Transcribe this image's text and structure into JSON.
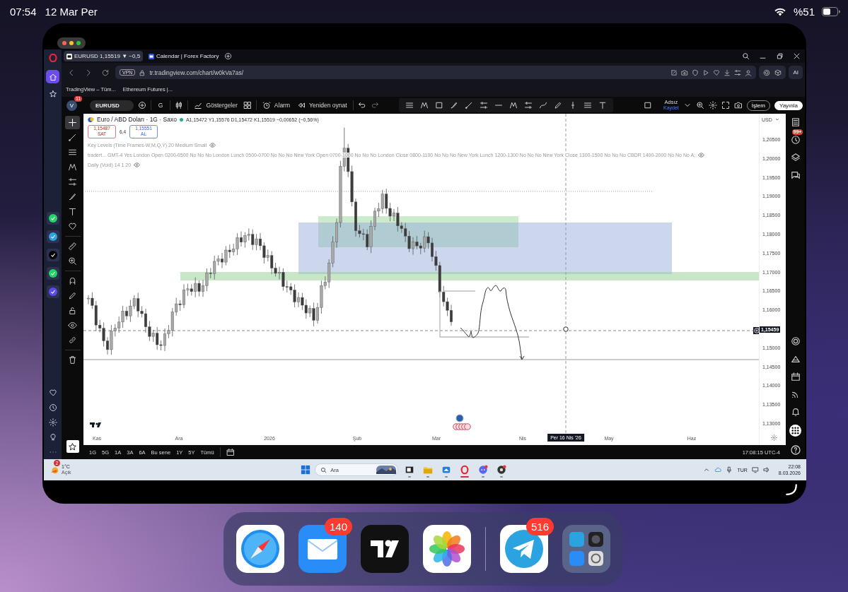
{
  "status_bar": {
    "time": "07:54",
    "date": "12 Mar Per",
    "battery": "%51"
  },
  "opera_sidebar": {
    "items": [
      {
        "selected": true
      },
      {
        "selected": false
      }
    ]
  },
  "browser": {
    "tabs": [
      {
        "label": "EURUSD 1,15519 ▼ −0,5",
        "selected": true
      },
      {
        "label": "Calendar | Forex Factory",
        "selected": false
      }
    ],
    "vpn": "VPN",
    "address": "tr.tradingview.com/chart/w0kVa7as/",
    "ai": "AI",
    "bookmarks": [
      "TradingView – Tüm...",
      "Ethereum Futures |..."
    ]
  },
  "toolbar": {
    "avatar": "V",
    "notifications": "11",
    "symbol": "EURUSD",
    "interval": "G",
    "indicators": "Göstergeler",
    "alert": "Alarm",
    "replay": "Yeniden oynat",
    "layout_name": "Adsız",
    "layout_status": "Kaydet",
    "trade": "İşlem",
    "publish": "Yayınla"
  },
  "left_toolbar": {
    "tools": [
      {
        "selected": true
      },
      {
        "selected": false
      },
      {
        "selected": false
      },
      {
        "selected": false
      },
      {
        "selected": false
      },
      {
        "selected": false
      },
      {
        "selected": false
      },
      {
        "selected": false
      },
      {
        "selected": false
      },
      {
        "selected": false
      },
      {
        "selected": false
      },
      {
        "selected": false
      },
      {
        "selected": false
      },
      {
        "selected": false
      },
      {
        "selected": false
      },
      {
        "selected": false
      }
    ]
  },
  "legend": {
    "title": "Euro / ABD Doları · 1G · Saxo",
    "ohlc": "A1,15472 Y1,15576 D1,15472 K1,15519 −0,00652 (−0,56%)",
    "sell_price": "1,15487",
    "sell_label": "SAT",
    "spread": "6,4",
    "buy_price": "1,15551",
    "buy_label": "AL",
    "indicators": [
      "Key Levels (Time Frames-W,M,Q,Y) 20 Medium Small",
      "tradert... GMT-4 Yes London Open 0200-0500 No No No London Lunch 0500-0700 No No No New York Open 0700-1000 No No No London Close 0800-1100 No No No New York Lunch 1200-1300 No No No New York Close 1300-1500 No No No CBDR 1400-2000 No No No A:",
      "Daily (Void) 14 1 20"
    ]
  },
  "price_axis": {
    "currency": "USD",
    "ticks": [
      "1,20500",
      "1,20000",
      "1,19500",
      "1,19000",
      "1,18500",
      "1,18000",
      "1,17500",
      "1,17000",
      "1,16500",
      "1,16000",
      "1,15000",
      "1,14500",
      "1,14000",
      "1,13500",
      "1,13000"
    ],
    "last_price": "1,15459"
  },
  "time_axis": {
    "labels": [
      "Kas",
      "Ara",
      "2026",
      "Şub",
      "Mar",
      "Nis",
      "May",
      "Haz"
    ],
    "crosshair_label": "Per 16 Nis '26"
  },
  "bottom_bar": {
    "ranges": [
      "1G",
      "5G",
      "1A",
      "3A",
      "6A",
      "Bu sene",
      "1Y",
      "5Y",
      "Tümü"
    ],
    "clock": "17:08:15 UTC-4"
  },
  "right_sidebar": {
    "badge": "99+"
  },
  "taskbar": {
    "weather_badge": "2",
    "temperature": "1°C",
    "condition": "Açık",
    "search": "Ara",
    "apps": [
      {
        "active": false
      },
      {
        "active": false
      },
      {
        "active": false
      },
      {
        "active": true
      },
      {
        "active": false
      },
      {
        "active": false
      }
    ],
    "language": "TUR",
    "time": "22:08",
    "date": "8.03.2026"
  },
  "dock": {
    "apps": [
      {
        "kind": "safari"
      },
      {
        "kind": "mail",
        "badge": "140"
      },
      {
        "kind": "tradingview"
      },
      {
        "kind": "photos"
      },
      {
        "kind": "telegram",
        "badge": "516"
      },
      {
        "kind": "folder"
      }
    ]
  }
}
